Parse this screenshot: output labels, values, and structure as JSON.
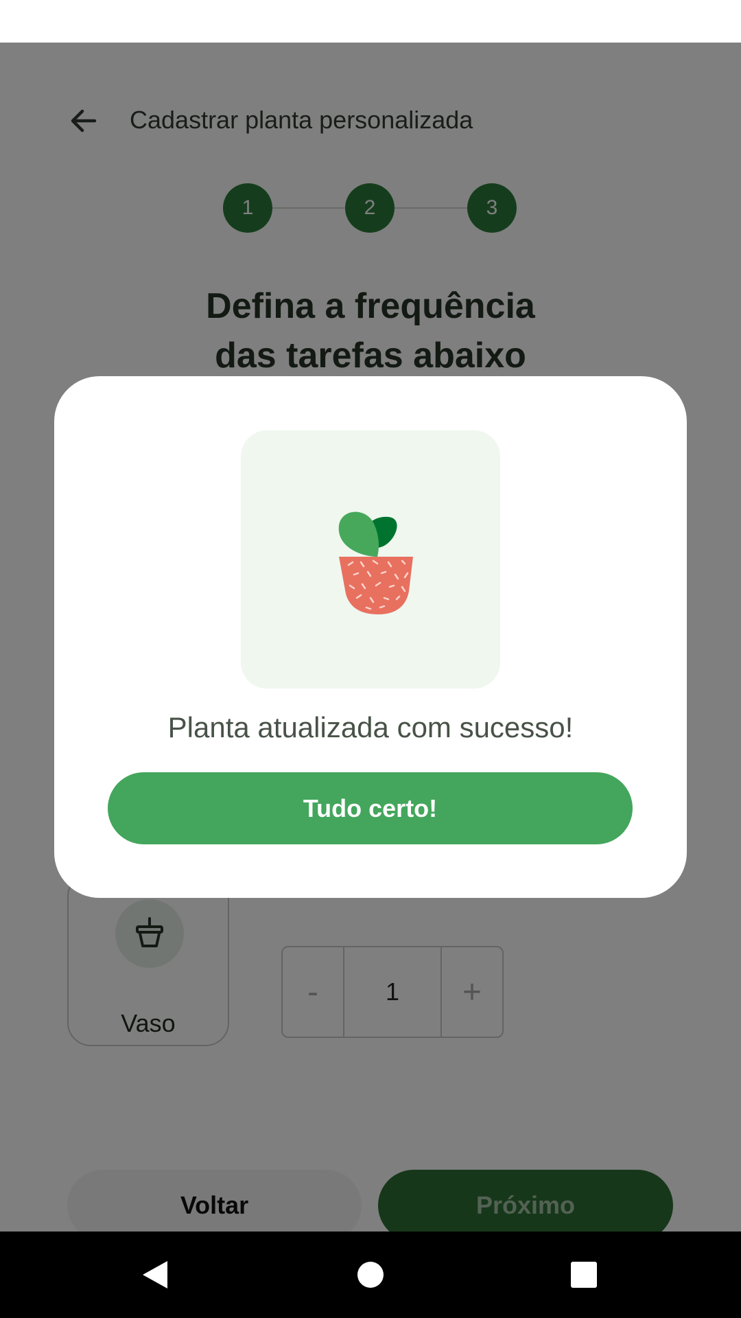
{
  "header": {
    "title": "Cadastrar planta personalizada",
    "back_icon": "arrow-left-icon"
  },
  "stepper": {
    "steps": [
      "1",
      "2",
      "3"
    ],
    "current": 3,
    "color": "#2b7a3a"
  },
  "main": {
    "heading_line1": "Defina a frequência",
    "heading_line2": "das tarefas abaixo",
    "task": {
      "label": "Vaso",
      "icon": "plant-pot-icon"
    },
    "quantity": {
      "decrement": "-",
      "value": "1",
      "increment": "+"
    }
  },
  "footer": {
    "back_label": "Voltar",
    "next_label": "Próximo"
  },
  "dialog": {
    "image": "potted-plant-illustration",
    "message": "Planta atualizada com sucesso!",
    "confirm_label": "Tudo certo!",
    "accent": "#43a65c"
  },
  "system_nav": {
    "back_icon": "triangle-back-icon",
    "home_icon": "circle-home-icon",
    "recents_icon": "square-recents-icon"
  }
}
